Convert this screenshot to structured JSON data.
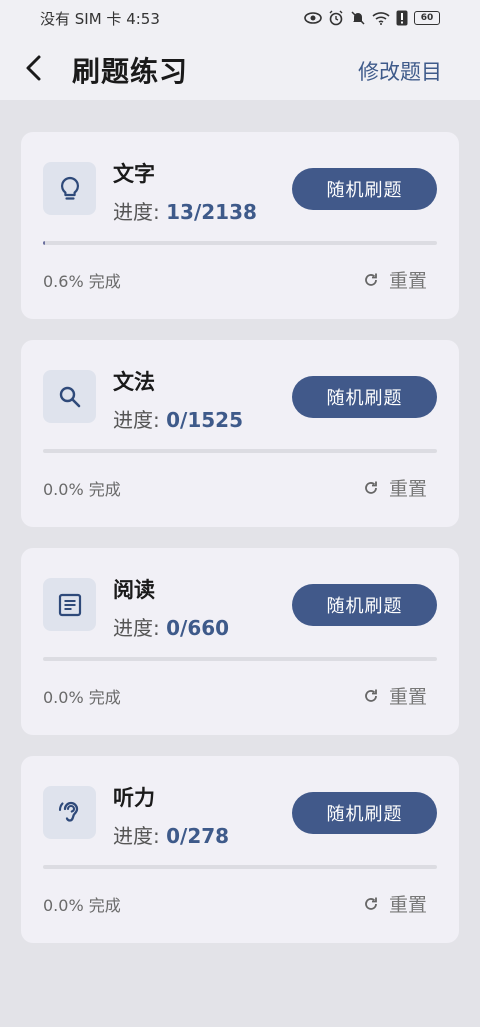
{
  "status": {
    "left_text": "没有 SIM 卡 4:53",
    "battery": "60"
  },
  "header": {
    "title": "刷题练习",
    "edit_label": "修改题目"
  },
  "cards": [
    {
      "title": "文字",
      "progress_label": "进度: ",
      "progress_value": "13/2138",
      "button": "随机刷题",
      "percent_text": "0.6% 完成",
      "percent": 0.6,
      "reset": "重置",
      "icon": "lightbulb-icon"
    },
    {
      "title": "文法",
      "progress_label": "进度: ",
      "progress_value": "0/1525",
      "button": "随机刷题",
      "percent_text": "0.0% 完成",
      "percent": 0.0,
      "reset": "重置",
      "icon": "search-icon"
    },
    {
      "title": "阅读",
      "progress_label": "进度: ",
      "progress_value": "0/660",
      "button": "随机刷题",
      "percent_text": "0.0% 完成",
      "percent": 0.0,
      "reset": "重置",
      "icon": "article-icon"
    },
    {
      "title": "听力",
      "progress_label": "进度: ",
      "progress_value": "0/278",
      "button": "随机刷题",
      "percent_text": "0.0% 完成",
      "percent": 0.0,
      "reset": "重置",
      "icon": "hearing-icon"
    }
  ],
  "colors": {
    "accent": "#41598a",
    "link": "#3e5a8a",
    "background": "#e3e3e8",
    "card": "#f1f0f6"
  }
}
